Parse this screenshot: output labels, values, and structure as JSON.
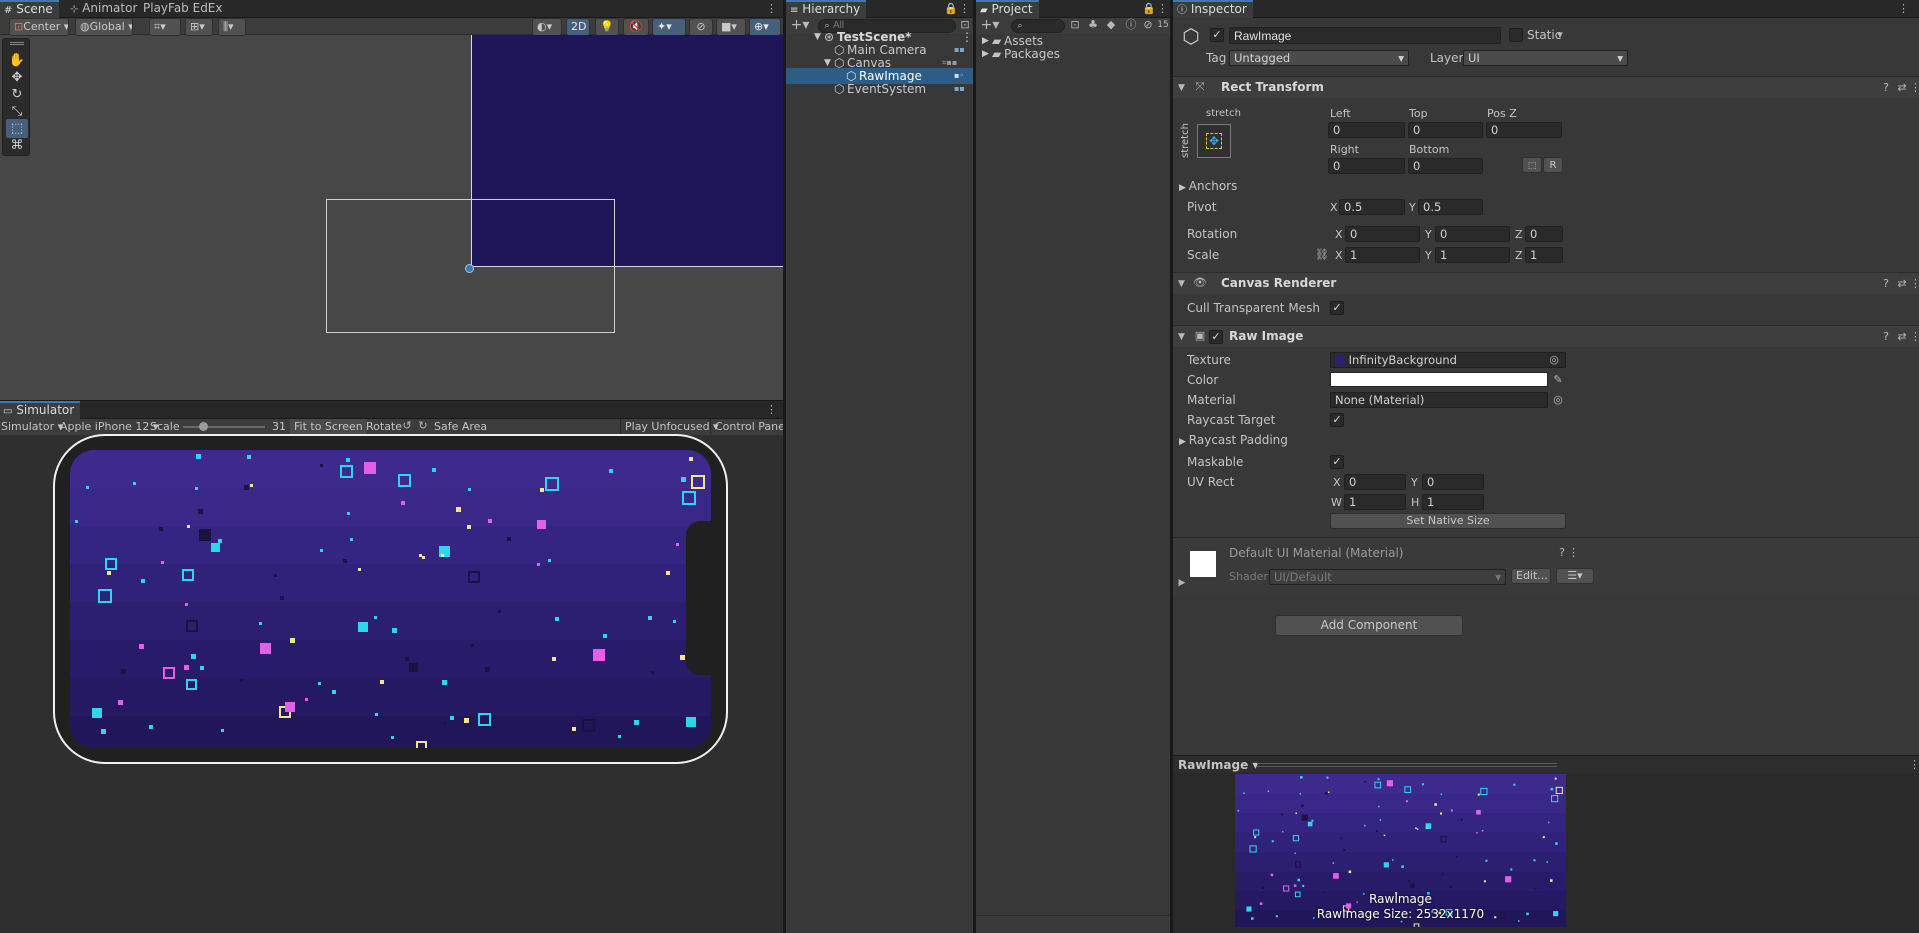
{
  "scene": {
    "tabs": [
      "Scene",
      "Animator",
      "PlayFab EdEx"
    ],
    "toolbar": {
      "pivot": "Center",
      "space": "Global",
      "mode_2d": "2D"
    }
  },
  "simulator": {
    "tab": "Simulator",
    "dropdown": "Simulator",
    "device": "Apple iPhone 12",
    "scale_label": "Scale",
    "scale_value": "31",
    "scale_fraction": 0.25,
    "fit_to_screen": "Fit to Screen",
    "rotate": "Rotate",
    "safe_area": "Safe Area",
    "play_mode": "Play Unfocused",
    "control_panel": "Control Panel"
  },
  "hierarchy": {
    "tab": "Hierarchy",
    "search_placeholder": "All",
    "scene_name": "TestScene*",
    "items": [
      {
        "label": "Main Camera"
      },
      {
        "label": "Canvas"
      },
      {
        "label": "RawImage"
      },
      {
        "label": "EventSystem"
      }
    ]
  },
  "project": {
    "tab": "Project",
    "badge": "15",
    "folders": [
      "Assets",
      "Packages"
    ]
  },
  "inspector": {
    "tab": "Inspector",
    "object_name": "RawImage",
    "static_label": "Static",
    "tag_label": "Tag",
    "tag_value": "Untagged",
    "layer_label": "Layer",
    "layer_value": "UI",
    "rect_transform": {
      "title": "Rect Transform",
      "stretch_top": "stretch",
      "stretch_side": "stretch",
      "left_label": "Left",
      "left": "0",
      "top_label": "Top",
      "top": "0",
      "posz_label": "Pos Z",
      "posz": "0",
      "right_label": "Right",
      "right": "0",
      "bottom_label": "Bottom",
      "bottom": "0",
      "r_button": "R",
      "anchors": "Anchors",
      "pivot_label": "Pivot",
      "pivot_x": "0.5",
      "pivot_y": "0.5",
      "rotation_label": "Rotation",
      "rot_x": "0",
      "rot_y": "0",
      "rot_z": "0",
      "scale_label": "Scale",
      "scale_x": "1",
      "scale_y": "1",
      "scale_z": "1",
      "x": "X",
      "y": "Y",
      "z": "Z"
    },
    "canvas_renderer": {
      "title": "Canvas Renderer",
      "cull_label": "Cull Transparent Mesh"
    },
    "raw_image": {
      "title": "Raw Image",
      "texture_label": "Texture",
      "texture_value": "InfinityBackground",
      "color_label": "Color",
      "color_value": "#ffffff",
      "material_label": "Material",
      "material_value": "None (Material)",
      "raycast_target": "Raycast Target",
      "raycast_padding": "Raycast Padding",
      "maskable": "Maskable",
      "uv_rect": "UV Rect",
      "uv_x": "0",
      "uv_y": "0",
      "uv_w": "1",
      "uv_h": "1",
      "w": "W",
      "h": "H",
      "set_native": "Set Native Size"
    },
    "material": {
      "title": "Default UI Material (Material)",
      "shader_label": "Shader",
      "shader_value": "UI/Default",
      "edit": "Edit..."
    },
    "add_component": "Add Component",
    "preview": {
      "dropdown": "RawImage",
      "name": "RawImage",
      "size": "RawImage Size: 2532x1170"
    }
  },
  "colors": {
    "accent": "#3a79bb",
    "night_sky": "#2b1f6e",
    "star_cyan": "#2fd5ea",
    "star_pink": "#e35fe8",
    "star_yellow": "#f1e58e"
  }
}
